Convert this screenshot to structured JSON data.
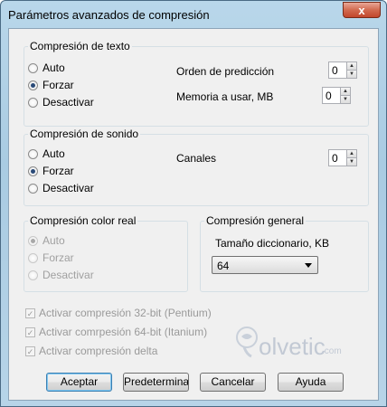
{
  "window": {
    "title": "Parámetros avanzados de compresión",
    "close_glyph": "x"
  },
  "text_group": {
    "title": "Compresión de texto",
    "options": [
      "Auto",
      "Forzar",
      "Desactivar"
    ],
    "selected": "Forzar",
    "order_label": "Orden de predicción",
    "order_value": "0",
    "memory_label": "Memoria a usar, MB",
    "memory_value": "0"
  },
  "sound_group": {
    "title": "Compresión de sonido",
    "options": [
      "Auto",
      "Forzar",
      "Desactivar"
    ],
    "selected": "Forzar",
    "channels_label": "Canales",
    "channels_value": "0"
  },
  "color_group": {
    "title": "Compresión color real",
    "options": [
      "Auto",
      "Forzar",
      "Desactivar"
    ],
    "selected": "Auto",
    "disabled": true
  },
  "general_group": {
    "title": "Compresión general",
    "dict_label": "Tamaño diccionario, KB",
    "dict_value": "64"
  },
  "checkboxes": [
    {
      "label": "Activar compresión 32-bit (Pentium)",
      "checked": true,
      "disabled": true
    },
    {
      "label": "Activar comrpesión 64-bit (Itanium)",
      "checked": true,
      "disabled": true
    },
    {
      "label": "Activar compresión delta",
      "checked": true,
      "disabled": true
    }
  ],
  "buttons": {
    "ok": "Aceptar",
    "default": "Predeterminado",
    "cancel": "Cancelar",
    "help": "Ayuda"
  },
  "watermark": {
    "word": "olvetic",
    "suffix": ".com"
  }
}
